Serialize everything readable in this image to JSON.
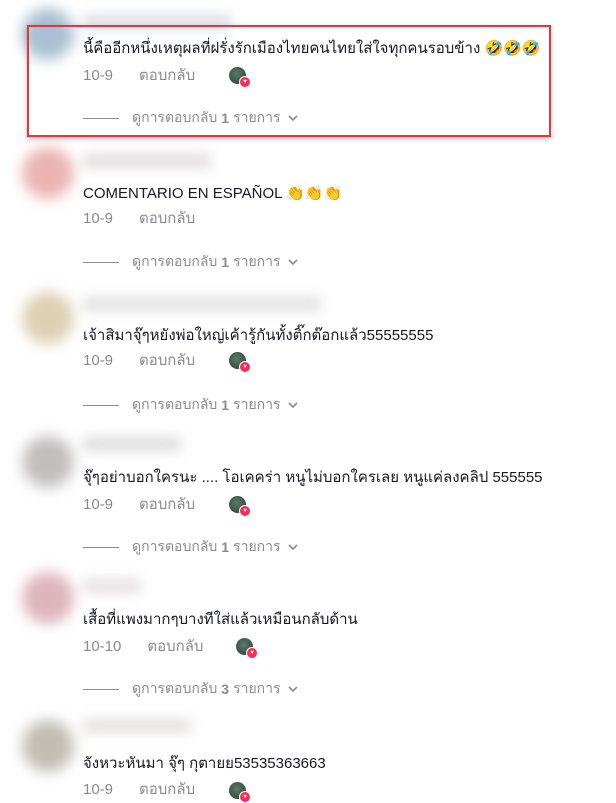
{
  "comments": [
    {
      "text": "นี้คืออีกหนึ่งเหตุผลที่ฝรั่งรักเมืองไทยคนไทยใส่ใจทุกคนรอบข้าง",
      "emojis": "🤣🤣🤣",
      "date": "10-9",
      "reply_label": "ตอบกลับ",
      "view_replies_label": "ดูการตอบกลับ",
      "reply_count": "1",
      "reply_unit": "รายการ",
      "avatar_color": "#9ab6c9",
      "highlighted": true
    },
    {
      "text": "COMENTARIO EN ESPAÑOL",
      "emojis": "👏👏👏",
      "date": "10-9",
      "reply_label": "ตอบกลับ",
      "view_replies_label": "ดูการตอบกลับ",
      "reply_count": "1",
      "reply_unit": "รายการ",
      "avatar_color": "#e8a7a4"
    },
    {
      "text": "เจ้าสิมาจุ๊ๆหยังพ่อใหญ่เค้ารู้กันทั้งติ๊กต๊อกแล้ว55555555",
      "emojis": "",
      "date": "10-9",
      "reply_label": "ตอบกลับ",
      "view_replies_label": "ดูการตอบกลับ",
      "reply_count": "1",
      "reply_unit": "รายการ",
      "avatar_color": "#d8c7a4"
    },
    {
      "text": "จุ๊ๆอย่าบอกใครนะ .... โอเคคร่า หนูไม่บอกใครเลย หนูแค่ลงคลิป 555555",
      "emojis": "",
      "date": "10-9",
      "reply_label": "ตอบกลับ",
      "view_replies_label": "ดูการตอบกลับ",
      "reply_count": "1",
      "reply_unit": "รายการ",
      "avatar_color": "#b9b3b3"
    },
    {
      "text": "เสื้อที่แพงมากๆบางทีใส่แล้วเหมือนกลับด้าน",
      "emojis": "",
      "date": "10-10",
      "reply_label": "ตอบกลับ",
      "view_replies_label": "ดูการตอบกลับ",
      "reply_count": "3",
      "reply_unit": "รายการ",
      "avatar_color": "#d9a8b1"
    },
    {
      "text": "จังหวะหันมา จุ๊ๆ กุตายย53535363663",
      "emojis": "",
      "date": "10-9",
      "reply_label": "ตอบกลับ",
      "avatar_color": "#b8b2a6"
    }
  ]
}
